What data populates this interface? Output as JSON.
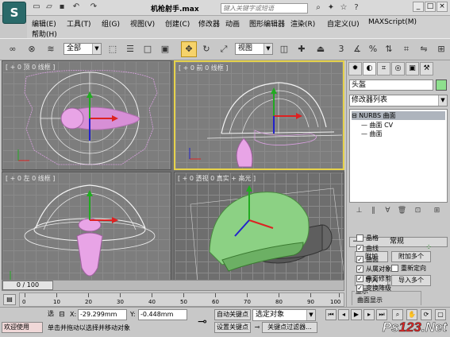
{
  "title_bar": {
    "file_name": "机枪射手.max",
    "search_placeholder": "键入关键字或短语",
    "quick_access_icons": [
      "new-file-icon",
      "open-file-icon",
      "save-icon",
      "undo-icon",
      "redo-icon"
    ]
  },
  "menu": {
    "items": [
      "编辑(E)",
      "工具(T)",
      "组(G)",
      "视图(V)",
      "创建(C)",
      "修改器",
      "动画",
      "图形编辑器",
      "渲染(R)",
      "自定义(U)",
      "MAXScript(M)",
      "帮助(H)"
    ]
  },
  "toolbar": {
    "selection_filter": "全部",
    "ref_coord": "视图"
  },
  "viewports": {
    "top": {
      "label": "[ + 0 顶 0 线框 ]"
    },
    "front": {
      "label": "[ + 0 前 0 线框 ]"
    },
    "left": {
      "label": "[ + 0 左 0 线框 ]"
    },
    "persp": {
      "label": "[ + 0 透视 0 真实 + 高光 ]"
    }
  },
  "command_panel": {
    "object_name": "头盔",
    "object_color": "#8ee08e",
    "modifier_list": "修改器列表",
    "stack": [
      {
        "label": "NURBS 曲面",
        "selected": true
      },
      {
        "label": "曲面 CV",
        "selected": false
      },
      {
        "label": "曲面",
        "selected": false
      }
    ],
    "rollout_title": "常规",
    "attach_btn": "附加",
    "attach_multi_btn": "附加多个",
    "reorient_label": "重新定向",
    "import_btn": "导入",
    "import_multi_btn": "导入多个",
    "display_group": "显示",
    "display_items": [
      {
        "label": "晶格",
        "checked": false
      },
      {
        "label": "曲线",
        "checked": true
      },
      {
        "label": "曲面",
        "checked": true
      },
      {
        "label": "从属对象",
        "checked": true
      },
      {
        "label": "曲面修剪",
        "checked": true
      },
      {
        "label": "变换降级",
        "checked": true
      }
    ],
    "next_group": "曲面显示"
  },
  "timeline": {
    "frame_label": "0 / 100",
    "ticks": [
      "0",
      "10",
      "20",
      "30",
      "40",
      "50",
      "60",
      "70",
      "80",
      "90",
      "100"
    ]
  },
  "status_bar": {
    "welcome": "欢迎使用",
    "select_count_label": "选",
    "prompt": "单击并拖动以选择并移动对象",
    "x_value": "-29.299mm",
    "y_value": "-0.448mm",
    "auto_key": "自动关键点",
    "selected_dropdown": "选定对象",
    "set_key": "设置关键点",
    "key_filters": "关键点过滤器..."
  },
  "watermark": {
    "part1": "Ps",
    "part2": "123",
    "part3": ".Net"
  }
}
